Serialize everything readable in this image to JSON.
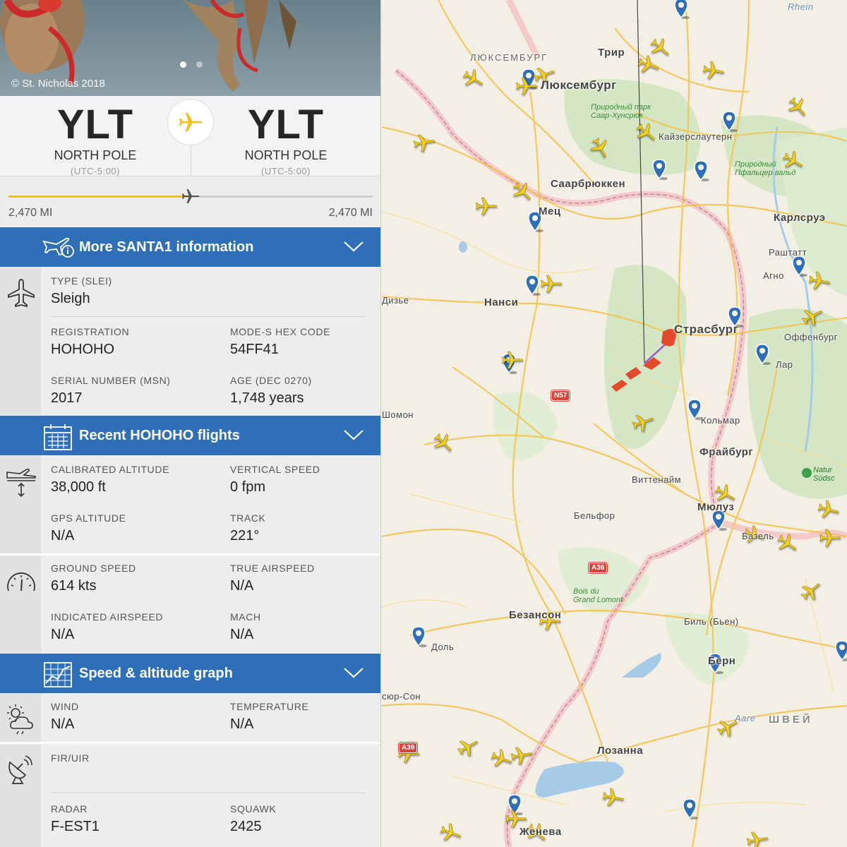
{
  "hero": {
    "credit": "© St. Nicholas 2018"
  },
  "route": {
    "origin": {
      "code": "YLT",
      "name": "NORTH POLE",
      "tz": "(UTC-5:00)"
    },
    "destination": {
      "code": "YLT",
      "name": "NORTH POLE",
      "tz": "(UTC-5:00)"
    },
    "distance_flown": "2,470 MI",
    "distance_remaining": "2,470 MI",
    "progress": 0.5
  },
  "sections": {
    "more_info": "More SANTA1 information",
    "recent_flights": "Recent HOHOHO flights",
    "graph": "Speed & altitude graph"
  },
  "aircraft": {
    "type_label": "TYPE (SLEI)",
    "type_value": "Sleigh",
    "reg_label": "REGISTRATION",
    "reg_value": "HOHOHO",
    "modes_label": "MODE-S HEX CODE",
    "modes_value": "54FF41",
    "serial_label": "SERIAL NUMBER (MSN)",
    "serial_value": "2017",
    "age_label": "AGE (DEC 0270)",
    "age_value": "1,748 years"
  },
  "altitude": {
    "cal_label": "CALIBRATED ALTITUDE",
    "cal_value": "38,000 ft",
    "vs_label": "VERTICAL SPEED",
    "vs_value": "0 fpm",
    "gps_label": "GPS ALTITUDE",
    "gps_value": "N/A",
    "track_label": "TRACK",
    "track_value": "221°"
  },
  "speed": {
    "gs_label": "GROUND SPEED",
    "gs_value": "614 kts",
    "tas_label": "TRUE AIRSPEED",
    "tas_value": "N/A",
    "ias_label": "INDICATED AIRSPEED",
    "ias_value": "N/A",
    "mach_label": "MACH",
    "mach_value": "N/A"
  },
  "weather": {
    "wind_label": "WIND",
    "wind_value": "N/A",
    "temp_label": "TEMPERATURE",
    "temp_value": "N/A"
  },
  "radar": {
    "fir_label": "FIR/UIR",
    "fir_value": "",
    "radar_label": "RADAR",
    "radar_value": "F-EST1",
    "squawk_label": "SQUAWK",
    "squawk_value": "2425"
  },
  "map": {
    "cities": {
      "lux_country": "ЛЮКСЕМБУРГ",
      "trier": "Трир",
      "luxembourg": "Люксембург",
      "kaiserslautern": "Кайзерслаутерн",
      "saarbrucken": "Саарбрюккен",
      "metz": "Мец",
      "karlsruhe": "Карлсруэ",
      "rastatt": "Раштатт",
      "agno": "Агно",
      "nancy": "Нанси",
      "strasbourg": "Страсбург",
      "offenburg": "Оффенбург",
      "lahr": "Лар",
      "chaumont": "Шомон",
      "colmar": "Кольмар",
      "freiburg": "Фрайбург",
      "wittenheim": "Виттенайм",
      "mulhouse": "Мюлуз",
      "belfort": "Бельфор",
      "basel": "Базель",
      "besancon": "Безансон",
      "biel": "Биль (Бьен)",
      "dole": "Доль",
      "bern": "Берн",
      "saone": "сюр-Сон",
      "switzerland": "ШВЕЙ",
      "lausanne": "Лозанна",
      "geneva": "Женева",
      "dieuze": "Дизье",
      "rhein": "Rhein",
      "aare": "Aare"
    },
    "parks": {
      "saar_hunsruck_1": "Природный парк",
      "saar_hunsruck_2": "Саар-Хунсрюк",
      "pfalz_1": "Природный",
      "pfalz_2": "Пфальцер вальд",
      "bois_1": "Bois du",
      "bois_2": "Grand Lomont",
      "natur_1": "Natur",
      "natur_2": "Südsc"
    },
    "roads": {
      "n57": "N57",
      "a36": "A36",
      "a39": "A39"
    },
    "colors": {
      "plane": "#f5d220",
      "pin": "#2f6fb7",
      "sleigh": "#e24a2b",
      "border": "#f0a7a7"
    }
  }
}
